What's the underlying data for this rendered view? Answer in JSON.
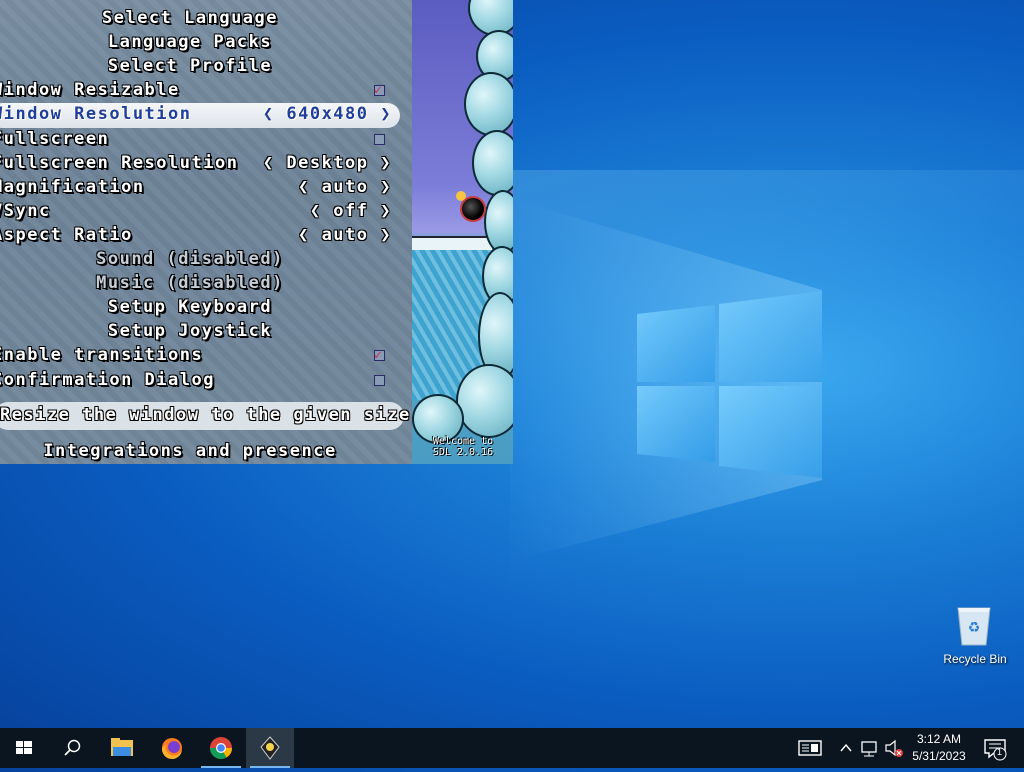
{
  "game": {
    "menu": [
      {
        "label": "Select Language",
        "align": "center"
      },
      {
        "label": "Language Packs",
        "align": "center"
      },
      {
        "label": "Select Profile",
        "align": "center"
      },
      {
        "label": "Window Resizable",
        "align": "left",
        "checkbox": true,
        "checked": true
      },
      {
        "label": "Window Resolution",
        "align": "left",
        "value": "640x480",
        "selected": true
      },
      {
        "label": "Fullscreen",
        "align": "left",
        "checkbox": true,
        "checked": false
      },
      {
        "label": "Fullscreen Resolution",
        "align": "left",
        "value": "Desktop"
      },
      {
        "label": "Magnification",
        "align": "left",
        "value": "auto"
      },
      {
        "label": "VSync",
        "align": "left",
        "value": "off"
      },
      {
        "label": "Aspect Ratio",
        "align": "left",
        "value": "auto"
      },
      {
        "label": "Sound (disabled)",
        "align": "center",
        "disabled": true
      },
      {
        "label": "Music (disabled)",
        "align": "center",
        "disabled": true
      },
      {
        "label": "Setup Keyboard",
        "align": "center"
      },
      {
        "label": "Setup Joystick",
        "align": "center"
      },
      {
        "label": "Enable transitions",
        "align": "left",
        "checkbox": true,
        "checked": true
      },
      {
        "label": "Confirmation Dialog",
        "align": "left",
        "checkbox": true,
        "checked": false
      }
    ],
    "tooltip": "Resize the window to the given size",
    "integrations": "Integrations and presence",
    "scene_text_line1": "Welcome to",
    "scene_text_line2": "SDL 2.0.16"
  },
  "desktop": {
    "recycle_bin_label": "Recycle Bin"
  },
  "taskbar": {
    "apps": [
      "start-icon",
      "search-icon",
      "file-explorer-icon",
      "firefox-icon",
      "chrome-icon",
      "supertux-icon"
    ],
    "clock_time": "3:12 AM",
    "clock_date": "5/31/2023",
    "notification_count": "1"
  },
  "colors": {
    "desktop_blue": "#0a5cc0",
    "taskbar": "#0b1520",
    "highlight_text": "#1f3f9a",
    "check_mark": "#d2304d"
  }
}
